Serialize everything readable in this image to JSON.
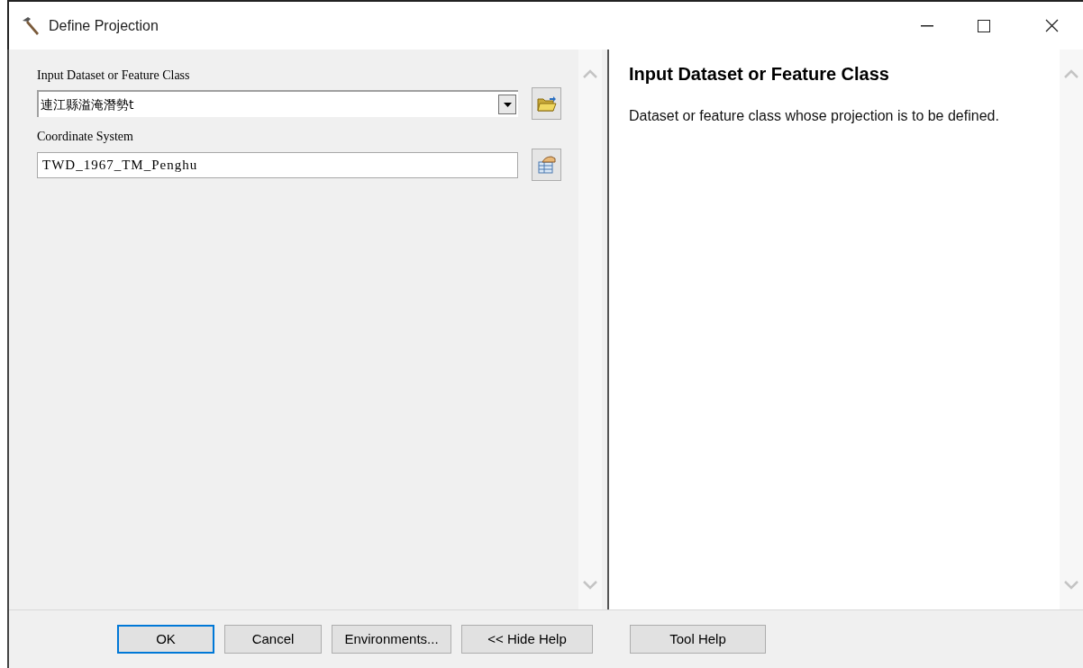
{
  "window": {
    "title": "Define Projection"
  },
  "parameters": [
    {
      "kind": "dropdown",
      "label": "Input Dataset or Feature Class",
      "value": "連江縣溢淹潛勢t"
    },
    {
      "kind": "text",
      "label": "Coordinate System",
      "value": "TWD_1967_TM_Penghu"
    }
  ],
  "help": {
    "title": "Input Dataset or Feature Class",
    "text": "Dataset or feature class whose projection is to be defined."
  },
  "buttons": [
    {
      "label": "OK",
      "focused": true
    },
    {
      "label": "Cancel",
      "focused": false
    },
    {
      "label": "Environments...",
      "focused": false
    },
    {
      "label": "<< Hide Help",
      "focused": false
    },
    {
      "label": "Tool Help",
      "focused": false
    }
  ]
}
